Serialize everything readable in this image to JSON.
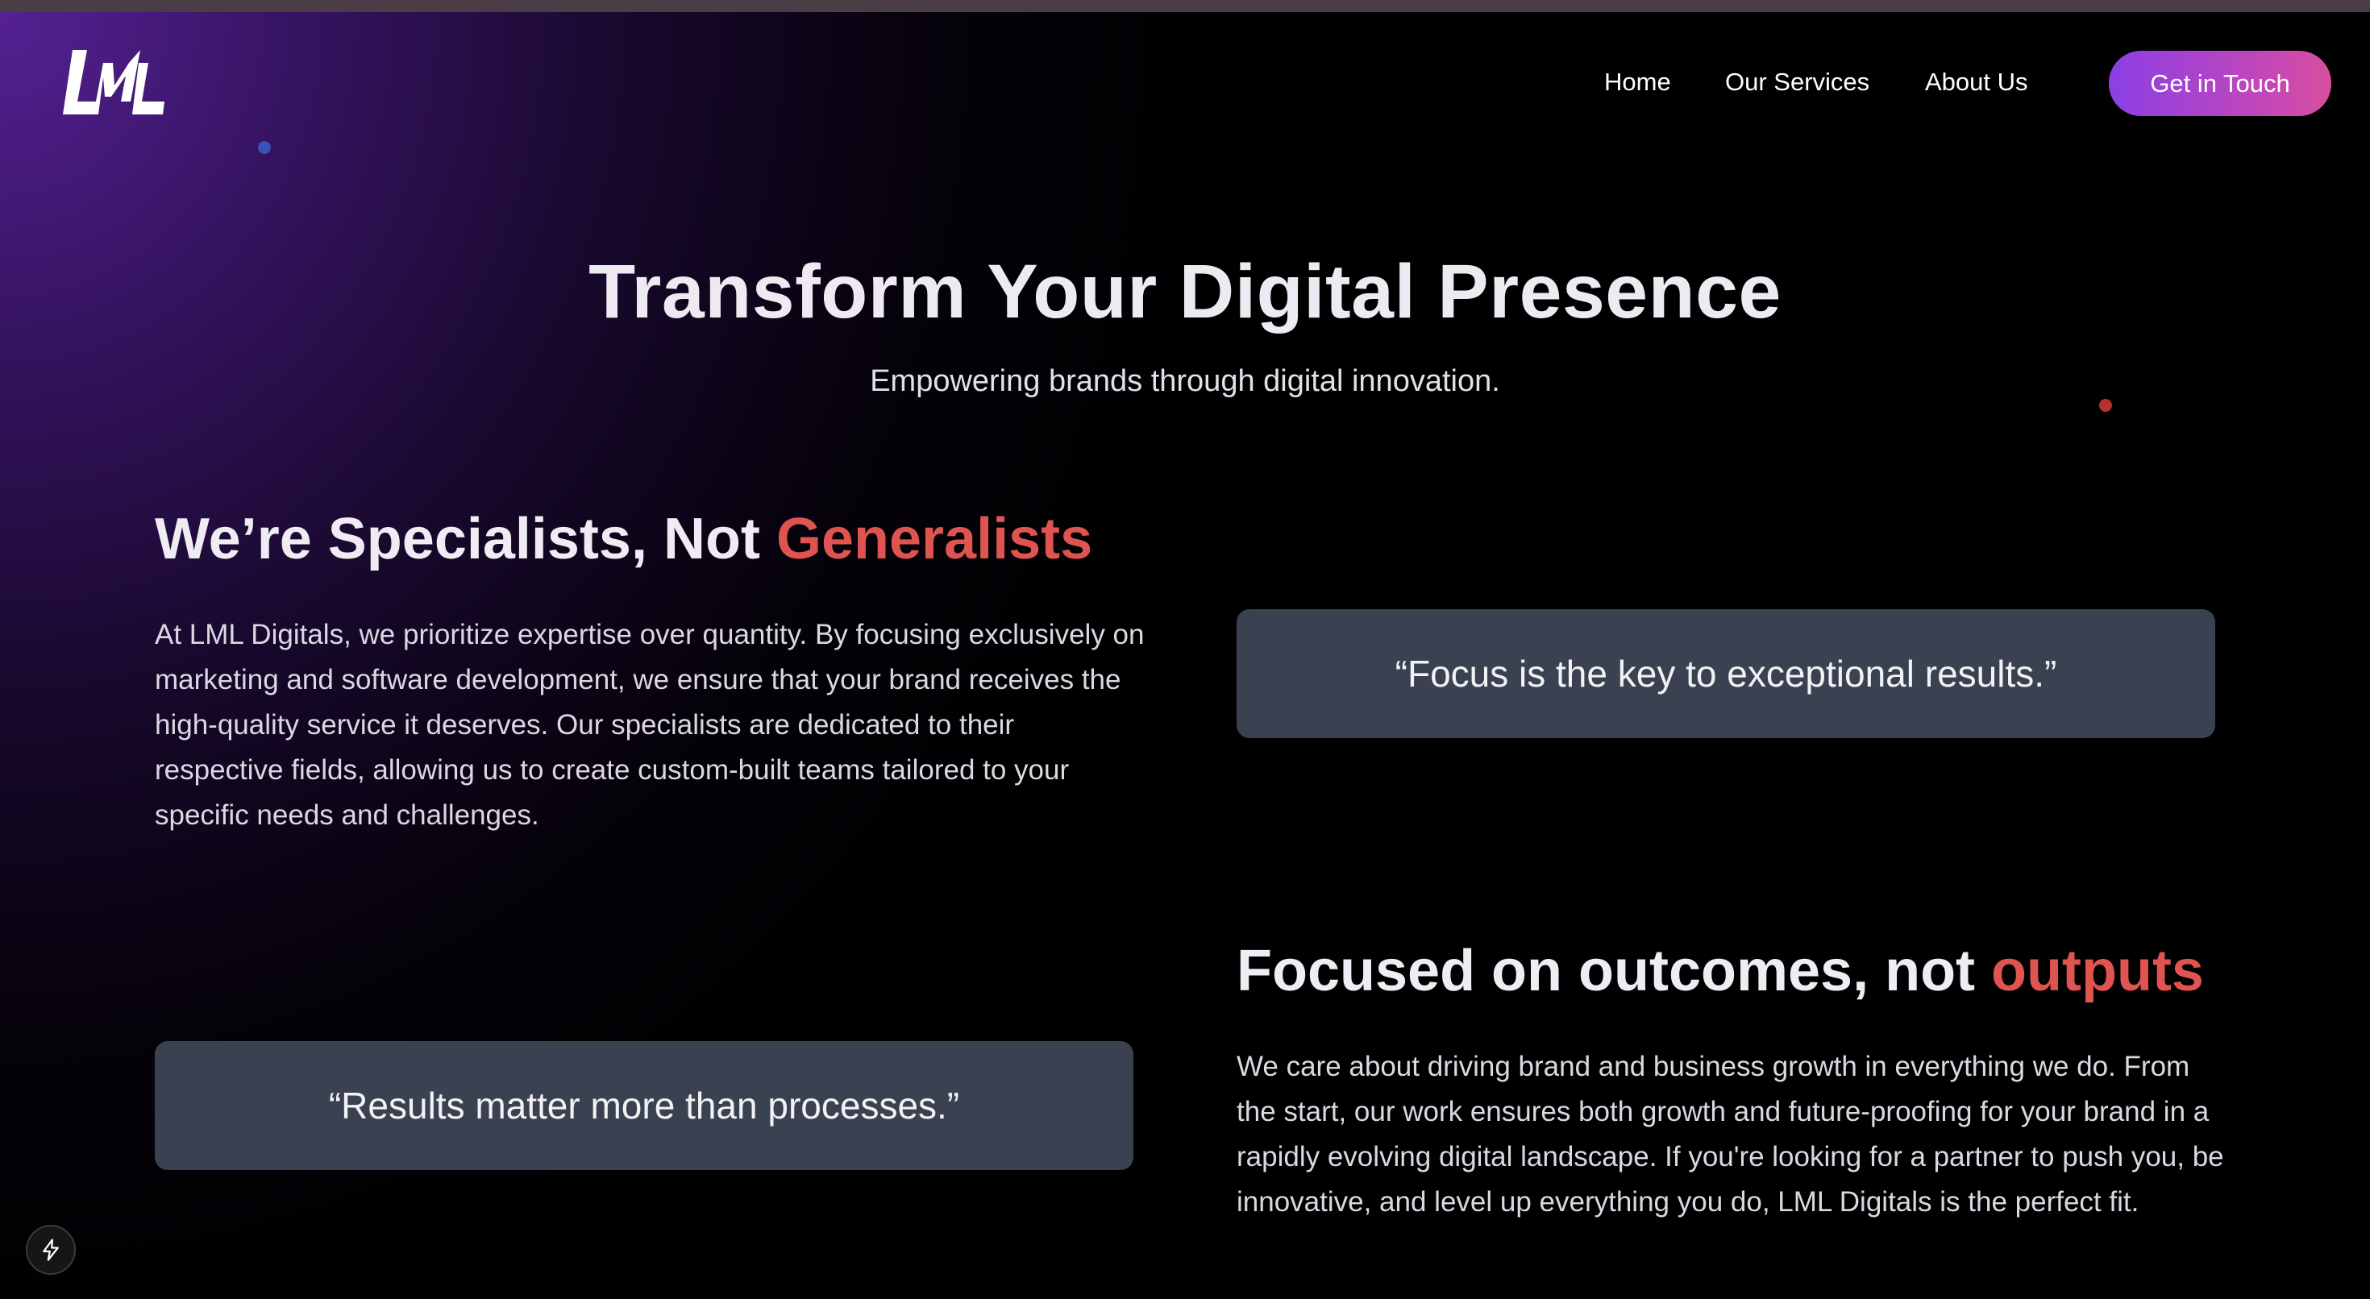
{
  "brand": {
    "logo_text": "LML",
    "accent_color": "#df5450"
  },
  "nav": {
    "links": [
      "Home",
      "Our Services",
      "About Us"
    ],
    "cta_label": "Get in Touch"
  },
  "hero": {
    "title": "Transform Your Digital Presence",
    "subtitle": "Empowering brands through digital innovation."
  },
  "section_specialists": {
    "title_main": "We’re Specialists, Not ",
    "title_accent": "Generalists",
    "body": "At LML Digitals, we prioritize expertise over quantity. By focusing exclusively on marketing and software development, we ensure that your brand receives the high-quality service it deserves. Our specialists are dedicated to their respective fields, allowing us to create custom-built teams tailored to your specific needs and challenges.",
    "quote": "“Focus is the key to exceptional results.”"
  },
  "section_outcomes": {
    "title_main": "Focused on outcomes, not ",
    "title_accent": "outputs",
    "body": "We care about driving brand and business growth in everything we do. From the start, our work ensures both growth and future-proofing for your brand in a rapidly evolving digital landscape. If you're looking for a partner to push you, be innovative, and level up everything you do, LML Digitals is the perfect fit.",
    "quote": "“Results matter more than processes.”"
  },
  "icons": {
    "floating_button": "lightning-bolt-icon"
  }
}
